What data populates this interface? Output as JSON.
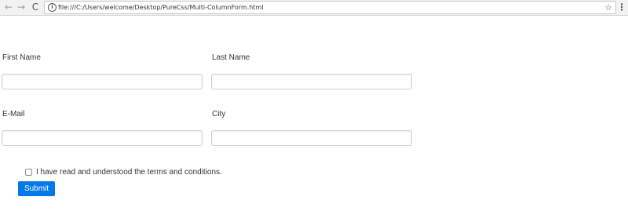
{
  "browser": {
    "url": "file:///C:/Users/welcome/Desktop/PureCss/Multi-ColumnForm.html",
    "back_icon": "←",
    "forward_icon": "→",
    "reload_icon": "C",
    "info_icon": "i",
    "star_icon": "☆",
    "menu_icon": "⋮"
  },
  "form": {
    "first_name": {
      "label": "First Name",
      "value": ""
    },
    "last_name": {
      "label": "Last Name",
      "value": ""
    },
    "email": {
      "label": "E-Mail",
      "value": ""
    },
    "city": {
      "label": "City",
      "value": ""
    },
    "terms": {
      "label": "I have read and understood the terms and conditions.",
      "checked": false
    },
    "submit_label": "Submit"
  },
  "colors": {
    "submit_bg": "#0078e7",
    "submit_text": "#ffffff"
  }
}
